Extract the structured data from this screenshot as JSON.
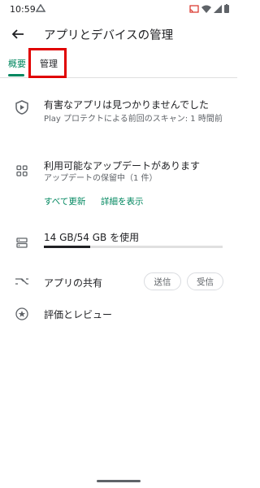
{
  "status_bar": {
    "time": "10:59",
    "icons": [
      "assistant-icon",
      "cast-icon",
      "wifi-icon",
      "signal-icon",
      "battery-icon"
    ]
  },
  "header": {
    "title": "アプリとデバイスの管理"
  },
  "tabs": [
    {
      "label": "概要",
      "selected": true
    },
    {
      "label": "管理",
      "selected": false
    }
  ],
  "accent_color": "#01875f",
  "highlight_color": "#e00000",
  "protect": {
    "title": "有害なアプリは見つかりませんでした",
    "subtitle": "Play プロテクトによる前回のスキャン: 1 時間前"
  },
  "updates": {
    "title": "利用可能なアップデートがあります",
    "subtitle": "アップデートの保留中（1 件）",
    "update_all": "すべて更新",
    "details": "詳細を表示"
  },
  "storage": {
    "label": "14 GB/54 GB を使用",
    "used_fraction": 0.26
  },
  "share": {
    "label": "アプリの共有",
    "send": "送信",
    "receive": "受信"
  },
  "ratings": {
    "label": "評価とレビュー"
  }
}
